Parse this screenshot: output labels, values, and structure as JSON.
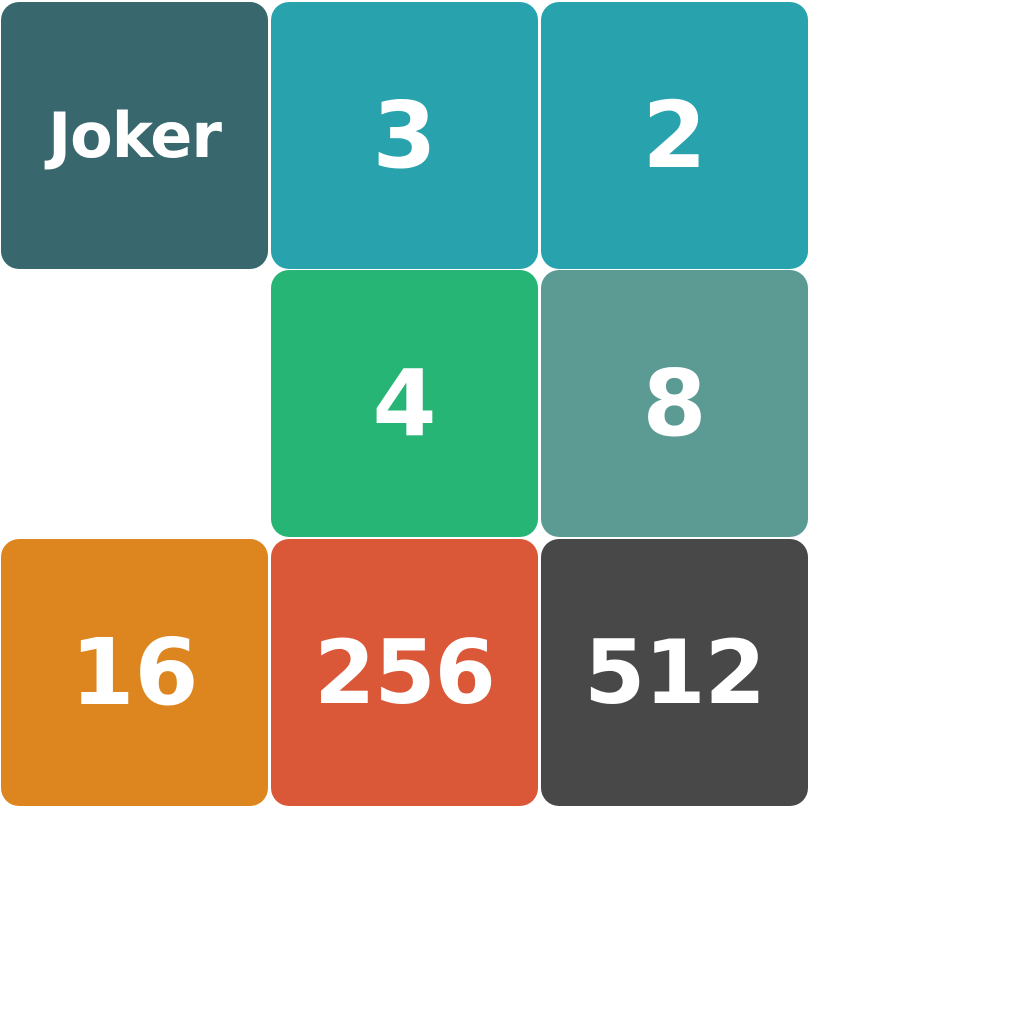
{
  "board": {
    "tiles": [
      {
        "id": "joker",
        "label": "Joker",
        "color": "#38686D"
      },
      {
        "id": "3",
        "label": "3",
        "color": "#28A3AD"
      },
      {
        "id": "2",
        "label": "2",
        "color": "#28A3AD"
      },
      {
        "id": "4",
        "label": "4",
        "color": "#26B574"
      },
      {
        "id": "8",
        "label": "8",
        "color": "#5C9B94"
      },
      {
        "id": "16",
        "label": "16",
        "color": "#DD861F"
      },
      {
        "id": "256",
        "label": "256",
        "color": "#DA5838"
      },
      {
        "id": "512",
        "label": "512",
        "color": "#484848"
      }
    ]
  }
}
